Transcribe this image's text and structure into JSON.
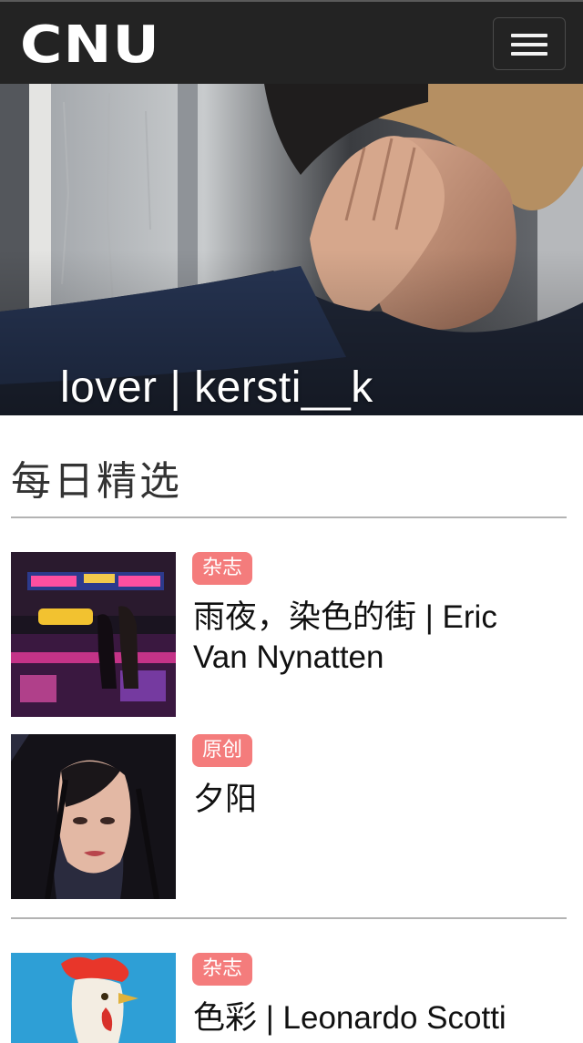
{
  "app": {
    "logo": "CNU",
    "menu_icon": "hamburger-menu-icon"
  },
  "banner": {
    "caption": "lover | kersti__k",
    "slide_count": 4,
    "active_slide": 1
  },
  "section": {
    "title": "每日精选"
  },
  "articles": [
    {
      "tag": "杂志",
      "title": "雨夜，染色的街 | Eric Van Nynatten",
      "image": "neon-street-night-photo"
    },
    {
      "tag": "原创",
      "title": "夕阳",
      "image": "portrait-woman-photo"
    },
    {
      "tag": "杂志",
      "title": "色彩 | Leonardo Scotti",
      "image": "rooster-photo"
    }
  ],
  "colors": {
    "navbar": "#232323",
    "tag": "#f47c7c",
    "divider": "#b3b3b3"
  }
}
